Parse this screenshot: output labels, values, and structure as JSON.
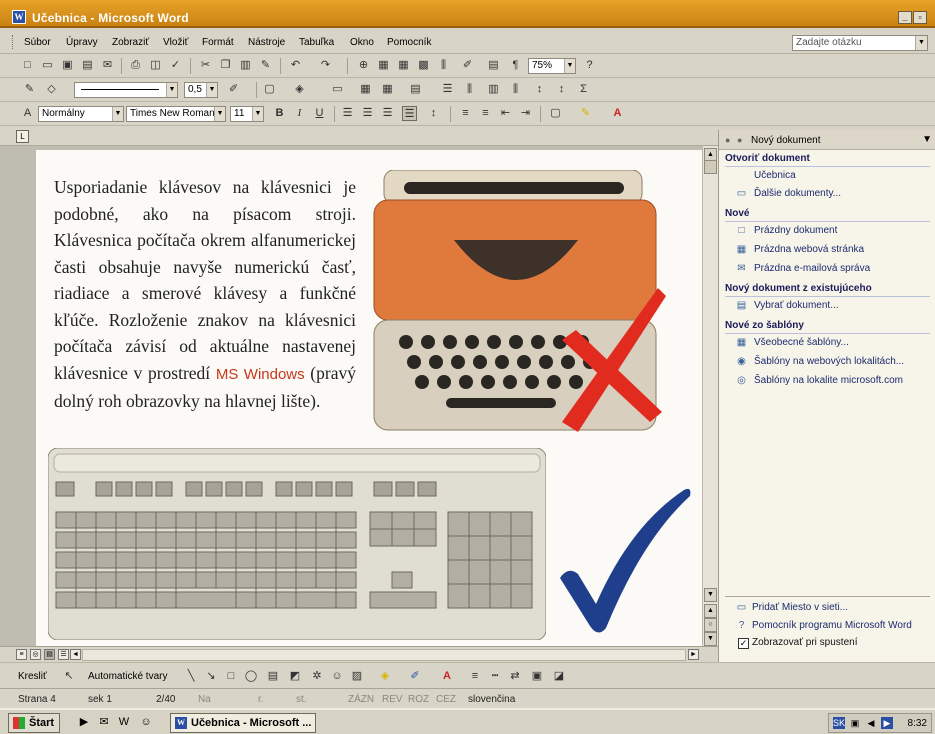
{
  "window": {
    "title": "Učebnica - Microsoft Word",
    "controls": [
      "_",
      "▫",
      "×"
    ]
  },
  "menu": {
    "items": [
      "Súbor",
      "Úpravy",
      "Zobraziť",
      "Vložiť",
      "Formát",
      "Nástroje",
      "Tabuľka",
      "Okno",
      "Pomocník"
    ],
    "ask_placeholder": "Zadajte otázku"
  },
  "toolbar_standard": {
    "zoom": "75%"
  },
  "toolbar_drawing_lines": {
    "line_width": "0,5"
  },
  "toolbar_formatting": {
    "style": "Normálny",
    "font": "Times New Roman",
    "size": "11",
    "bold": "B",
    "italic": "I",
    "underline": "U"
  },
  "document": {
    "text_before": "Usporiadanie klávesov na klávesnici je podobné, ako na písacom stroji. Klávesnica počítača okrem alfanumerickej časti obsahuje navyše numerickú časť, riadiace a smerové klávesy a funkčné kľúče. Rozloženie znakov na klávesnici počítača závisí od aktuálne nastavenej klávesnice v prostredí ",
    "highlight": "MS Windows",
    "text_after": " (pravý dolný roh obrazovky na hlavnej lište)."
  },
  "task_pane": {
    "title": "Nový dokument",
    "sections": [
      {
        "heading": "Otvoriť dokument",
        "links": [
          "Učebnica",
          "Ďalšie dokumenty..."
        ]
      },
      {
        "heading": "Nové",
        "links": [
          "Prázdny dokument",
          "Prázdna webová stránka",
          "Prázdna e-mailová správa"
        ]
      },
      {
        "heading": "Nový dokument z existujúceho",
        "links": [
          "Vybrať dokument..."
        ]
      },
      {
        "heading": "Nové zo šablóny",
        "links": [
          "Všeobecné šablóny...",
          "Šablóny na webových lokalitách...",
          "Šablóny na lokalite microsoft.com"
        ]
      }
    ],
    "bottom": {
      "add_place": "Pridať Miesto v sieti...",
      "help": "Pomocník programu Microsoft Word",
      "show_at_startup": "Zobrazovať pri spustení"
    }
  },
  "drawing_toolbar": {
    "draw": "Kresliť",
    "autoshapes": "Automatické tvary"
  },
  "status": {
    "page": "Strana 4",
    "section": "sek 1",
    "pages": "2/40",
    "at": "Na",
    "ln": "r.",
    "col": "st.",
    "rec": "ZÁZN",
    "trk": "REV",
    "ext": "ROZ",
    "ovr": "CEZ",
    "language": "slovenčina"
  },
  "taskbar": {
    "start": "Štart",
    "task": "Učebnica - Microsoft ...",
    "tray_lang": "SK",
    "clock": "8:32"
  }
}
